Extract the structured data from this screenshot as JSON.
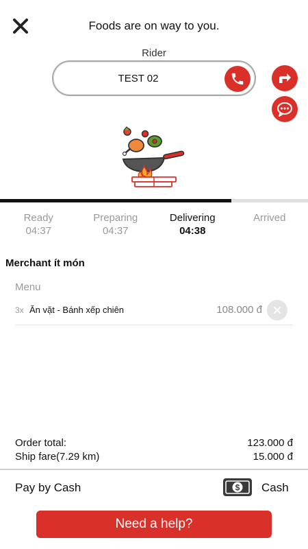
{
  "header": {
    "title": "Foods are on way to you.",
    "close_icon": "close-icon"
  },
  "rider": {
    "label": "Rider",
    "name": "TEST 02",
    "call_icon": "phone-icon",
    "share_icon": "share-arrow-icon",
    "chat_icon": "chat-bubble-icon"
  },
  "progress": {
    "fraction": 0.75
  },
  "steps": [
    {
      "label": "Ready",
      "time": "04:37",
      "active": false
    },
    {
      "label": "Preparing",
      "time": "04:37",
      "active": false
    },
    {
      "label": "Delivering",
      "time": "04:38",
      "active": true
    },
    {
      "label": "Arrived",
      "time": "",
      "active": false
    }
  ],
  "order": {
    "merchant": "Merchant ít món",
    "menu_label": "Menu",
    "items": [
      {
        "qty": "3x",
        "name": "Ăn vặt - Bánh xếp chiên",
        "price": "108.000 đ"
      }
    ]
  },
  "totals": [
    {
      "label": "Order total:",
      "value": "123.000 đ"
    },
    {
      "label": "Ship fare(7.29 km)",
      "value": "15.000 đ"
    }
  ],
  "payment": {
    "label": "Pay by Cash",
    "method": "Cash",
    "icon": "cash-icon"
  },
  "help_button": "Need a help?",
  "colors": {
    "accent": "#d9302a",
    "text": "#111111",
    "muted": "#9a9a9a"
  }
}
